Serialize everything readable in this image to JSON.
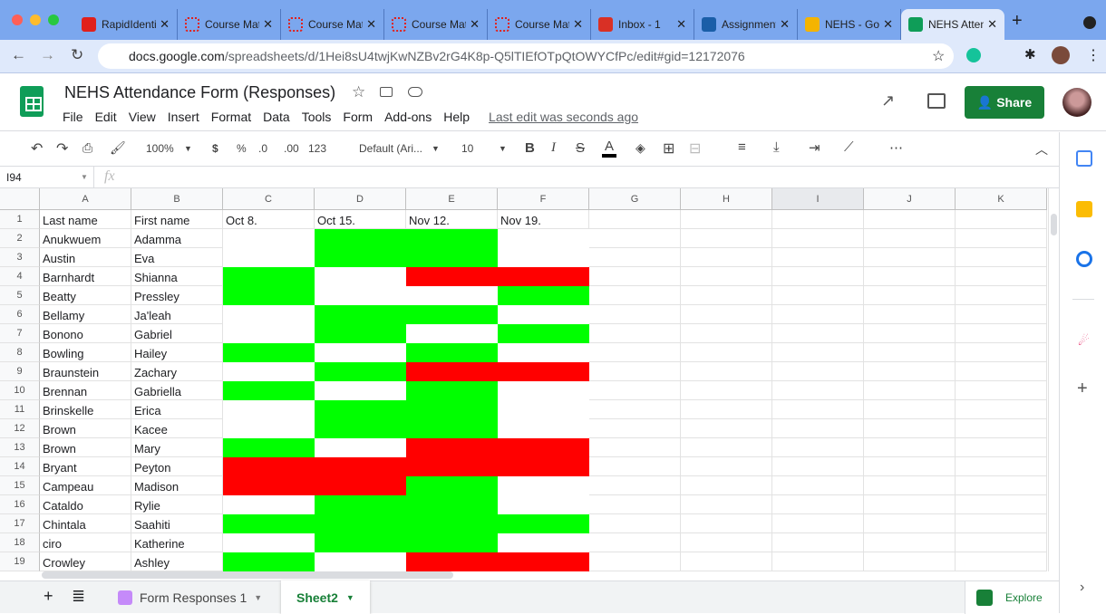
{
  "browser": {
    "tabs": [
      {
        "title": "RapidIdentity",
        "icon_color": "#e0201c"
      },
      {
        "title": "Course Materials",
        "icon_color": "#e0201c"
      },
      {
        "title": "Course Materials",
        "icon_color": "#e0201c"
      },
      {
        "title": "Course Materials",
        "icon_color": "#e0201c"
      },
      {
        "title": "Course Materials",
        "icon_color": "#e0201c"
      },
      {
        "title": "Inbox - 1",
        "icon_color": "#d93025"
      },
      {
        "title": "Assignments",
        "icon_color": "#1a5ea8"
      },
      {
        "title": "NEHS - Google Drive",
        "icon_color": "#f4b400"
      },
      {
        "title": "NEHS Attendance",
        "icon_color": "#0f9d58",
        "active": true
      }
    ],
    "url_host": "docs.google.com",
    "url_path": "/spreadsheets/d/1Hei8sU4twjKwNZBv2rG4K8p-Q5lTIEfOTpQtOWYCfPc/edit#gid=12172076"
  },
  "doc": {
    "title": "NEHS Attendance Form (Responses)",
    "menu": [
      "File",
      "Edit",
      "View",
      "Insert",
      "Format",
      "Data",
      "Tools",
      "Form",
      "Add-ons",
      "Help"
    ],
    "last_edit": "Last edit was seconds ago",
    "share_label": "Share"
  },
  "toolbar": {
    "zoom": "100%",
    "currency": "$",
    "percent": "%",
    "dec_less": ".0",
    "dec_more": ".00",
    "format": "123",
    "font": "Default (Ari...",
    "size": "10",
    "bold": "B",
    "italic": "I",
    "strike": "S",
    "text_color": "A",
    "more": "⋯"
  },
  "formula_bar": {
    "cell_ref": "I94",
    "fx": "fx",
    "value": ""
  },
  "colors": {
    "present": "#00ff00",
    "absent": "#ff0000",
    "empty": "#ffffff"
  },
  "grid": {
    "columns": [
      "A",
      "B",
      "C",
      "D",
      "E",
      "F",
      "G",
      "H",
      "I",
      "J",
      "K"
    ],
    "header_row": [
      "Last name",
      "First name",
      "Oct 8.",
      "Oct 15.",
      "Nov 12.",
      "Nov 19."
    ],
    "rows": [
      {
        "last": "Anukwuem",
        "first": "Adamma",
        "status": [
          "",
          "present",
          "present",
          ""
        ]
      },
      {
        "last": "Austin",
        "first": "Eva",
        "status": [
          "",
          "present",
          "present",
          ""
        ]
      },
      {
        "last": "Barnhardt",
        "first": "Shianna",
        "status": [
          "present",
          "",
          "absent",
          "absent"
        ]
      },
      {
        "last": "Beatty",
        "first": "Pressley",
        "status": [
          "present",
          "",
          "",
          "present"
        ]
      },
      {
        "last": "Bellamy",
        "first": "Ja'leah",
        "status": [
          "",
          "present",
          "present",
          ""
        ]
      },
      {
        "last": "Bonono",
        "first": "Gabriel",
        "status": [
          "",
          "present",
          "",
          "present"
        ]
      },
      {
        "last": "Bowling",
        "first": "Hailey",
        "status": [
          "present",
          "",
          "present",
          ""
        ]
      },
      {
        "last": "Braunstein",
        "first": "Zachary",
        "status": [
          "",
          "present",
          "absent",
          "absent"
        ]
      },
      {
        "last": "Brennan",
        "first": "Gabriella",
        "status": [
          "present",
          "",
          "present",
          ""
        ]
      },
      {
        "last": "Brinskelle",
        "first": "Erica",
        "status": [
          "",
          "present",
          "present",
          ""
        ]
      },
      {
        "last": "Brown",
        "first": "Kacee",
        "status": [
          "",
          "present",
          "present",
          ""
        ]
      },
      {
        "last": "Brown",
        "first": "Mary",
        "status": [
          "present",
          "",
          "absent",
          "absent"
        ]
      },
      {
        "last": "Bryant",
        "first": "Peyton",
        "status": [
          "absent",
          "absent",
          "absent",
          "absent"
        ]
      },
      {
        "last": "Campeau",
        "first": "Madison",
        "status": [
          "absent",
          "absent",
          "present",
          ""
        ]
      },
      {
        "last": "Cataldo",
        "first": "Rylie",
        "status": [
          "",
          "present",
          "present",
          ""
        ]
      },
      {
        "last": "Chintala",
        "first": "Saahiti",
        "status": [
          "present",
          "present",
          "present",
          "present"
        ]
      },
      {
        "last": "ciro",
        "first": "Katherine",
        "status": [
          "",
          "present",
          "present",
          ""
        ]
      },
      {
        "last": "Crowley",
        "first": "Ashley",
        "status": [
          "present",
          "",
          "absent",
          "absent"
        ]
      }
    ]
  },
  "sheets": {
    "tabs": [
      {
        "label": "Form Responses 1"
      },
      {
        "label": "Sheet2",
        "active": true
      }
    ],
    "explore": "Explore"
  }
}
